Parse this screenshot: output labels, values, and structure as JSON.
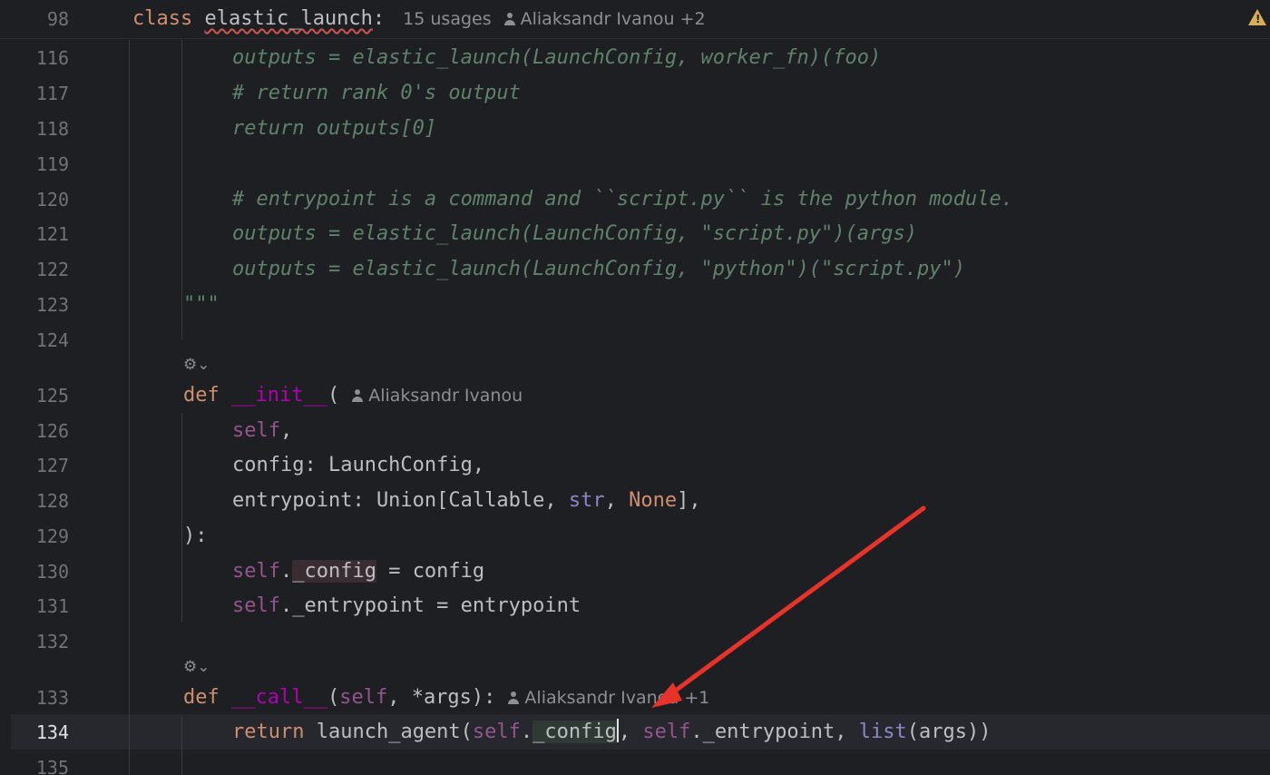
{
  "sticky": {
    "line_no": "98",
    "kw_class": "class",
    "class_name": "elastic_launch",
    "colon": ":",
    "usages": "15 usages",
    "authors": "Aliaksandr Ivanou +2"
  },
  "gutter": [
    "116",
    "117",
    "118",
    "119",
    "120",
    "121",
    "122",
    "123",
    "124",
    "125",
    "126",
    "127",
    "128",
    "129",
    "130",
    "131",
    "132",
    "133",
    "134",
    "135"
  ],
  "lines": {
    "l116": "outputs = elastic_launch(LaunchConfig, worker_fn)(foo)",
    "l117": "# return rank 0's output",
    "l118": "return outputs[0]",
    "l120": "# entrypoint is a command and ``script.py`` is the python module.",
    "l121": "outputs = elastic_launch(LaunchConfig, \"script.py\")(args)",
    "l122": "outputs = elastic_launch(LaunchConfig, \"python\")(\"script.py\")",
    "l123": "\"\"\"",
    "l125_kw": "def",
    "l125_name": "__init__",
    "l125_paren": "(",
    "l125_author": "Aliaksandr Ivanou",
    "l126_self": "self",
    "l126_rest": ",",
    "l127": "config: LaunchConfig,",
    "l128_a": "entrypoint: Union[Callable, ",
    "l128_str": "str",
    "l128_b": ", ",
    "l128_none": "None",
    "l128_c": "],",
    "l129": "):",
    "l130_self": "self",
    "l130_dot": ".",
    "l130_attr": "_config",
    "l130_rest": " = config",
    "l131_self": "self",
    "l131_rest": "._entrypoint = entrypoint",
    "l133_kw": "def",
    "l133_name": "__call__",
    "l133_p1": "(",
    "l133_self": "self",
    "l133_p2": ", *args):",
    "l133_author": "Aliaksandr Ivanou +1",
    "l134_kw": "return",
    "l134_a": " launch_agent(",
    "l134_self1": "self",
    "l134_dot": ".",
    "l134_attr": "_config",
    "l134_b": ", ",
    "l134_self2": "self",
    "l134_c": "._entrypoint, ",
    "l134_list": "list",
    "l134_d": "(args))"
  },
  "colors": {
    "background": "#1e1f22",
    "keyword": "#cf8e6d",
    "self": "#94558d",
    "docstring": "#5f826b",
    "annotation_arrow": "#e8332a"
  },
  "icons": {
    "ai_action": "ai-sparkle-icon",
    "warning": "warning-icon",
    "author": "person-icon"
  }
}
